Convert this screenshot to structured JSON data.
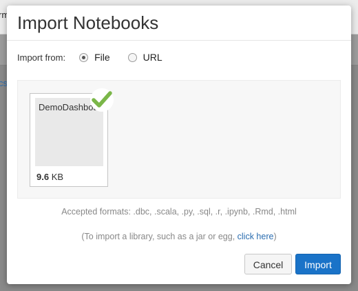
{
  "background": {
    "header_fragment": "rm",
    "sidebar_fragment": "cs"
  },
  "modal": {
    "title": "Import Notebooks",
    "import_from_label": "Import from:",
    "options": [
      {
        "label": "File",
        "selected": true
      },
      {
        "label": "URL",
        "selected": false
      }
    ],
    "file": {
      "name": "DemoDashboard",
      "size_value": "9.6",
      "size_unit": "KB",
      "status_icon": "checkmark-icon",
      "status_color": "#7ab648"
    },
    "accepted_formats": "Accepted formats: .dbc, .scala, .py, .sql, .r, .ipynb, .Rmd, .html",
    "library_note_prefix": "(To import a library, such as a jar or egg, ",
    "library_link": "click here",
    "library_note_suffix": ")",
    "cancel_label": "Cancel",
    "import_label": "Import"
  },
  "colors": {
    "primary": "#1a73c8",
    "link": "#2a6db0",
    "success": "#7ab648"
  }
}
